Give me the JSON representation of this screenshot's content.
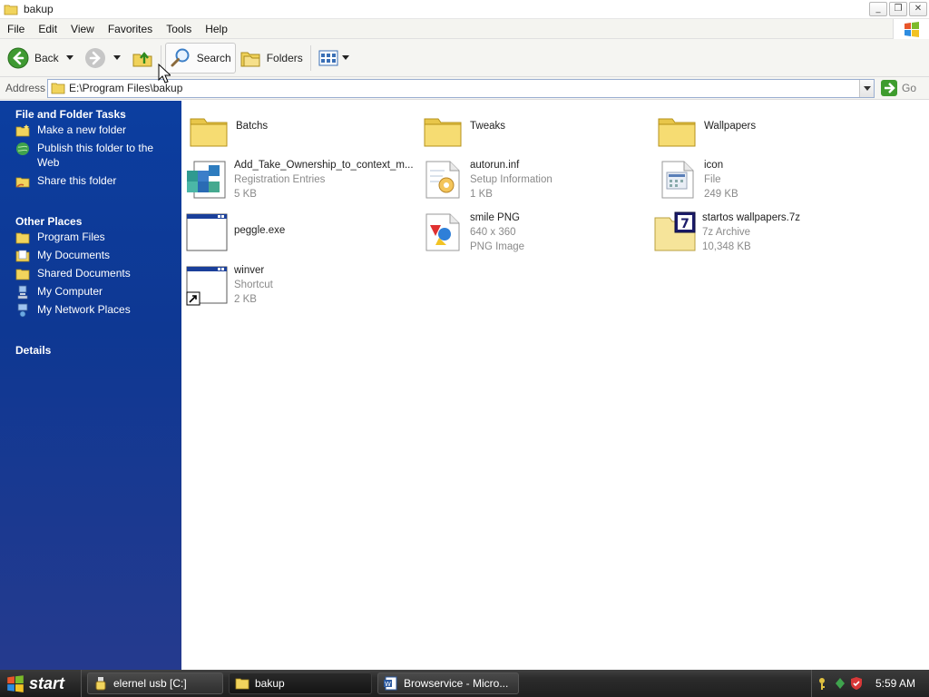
{
  "window": {
    "title": "bakup",
    "buttons": [
      "minimize",
      "maximize",
      "close"
    ]
  },
  "menu": [
    "File",
    "Edit",
    "View",
    "Favorites",
    "Tools",
    "Help"
  ],
  "toolbar": {
    "back_label": "Back",
    "search_label": "Search",
    "folders_label": "Folders"
  },
  "address": {
    "label": "Address",
    "path": "E:\\Program Files\\bakup",
    "go_label": "Go"
  },
  "leftpane": {
    "file_tasks_title": "File and Folder Tasks",
    "file_tasks": [
      {
        "label": "Make a new folder",
        "icon": "new-folder-icon"
      },
      {
        "label": "Publish this folder to the Web",
        "icon": "publish-web-icon"
      },
      {
        "label": "Share this folder",
        "icon": "share-folder-icon"
      }
    ],
    "other_places_title": "Other Places",
    "other_places": [
      {
        "label": "Program Files",
        "icon": "folder-icon"
      },
      {
        "label": "My Documents",
        "icon": "my-documents-icon"
      },
      {
        "label": "Shared Documents",
        "icon": "folder-icon"
      },
      {
        "label": "My Computer",
        "icon": "my-computer-icon"
      },
      {
        "label": "My Network Places",
        "icon": "network-places-icon"
      }
    ],
    "details_title": "Details"
  },
  "files": [
    {
      "name": "Batchs",
      "type": "",
      "size": "",
      "icon": "folder-icon"
    },
    {
      "name": "Tweaks",
      "type": "",
      "size": "",
      "icon": "folder-icon"
    },
    {
      "name": "Wallpapers",
      "type": "",
      "size": "",
      "icon": "folder-icon"
    },
    {
      "name": "Add_Take_Ownership_to_context_m...",
      "type": "Registration Entries",
      "size": "5 KB",
      "icon": "registry-file-icon"
    },
    {
      "name": "autorun.inf",
      "type": "Setup Information",
      "size": "1 KB",
      "icon": "setup-info-icon"
    },
    {
      "name": "icon",
      "type": "File",
      "size": "249 KB",
      "icon": "generic-file-icon"
    },
    {
      "name": "peggle.exe",
      "type": "",
      "size": "",
      "icon": "application-icon"
    },
    {
      "name": "smile PNG",
      "type": "640 x 360",
      "size": "PNG Image",
      "icon": "png-image-icon"
    },
    {
      "name": "startos wallpapers.7z",
      "type": "7z Archive",
      "size": "10,348 KB",
      "icon": "7z-archive-icon"
    },
    {
      "name": "winver",
      "type": "Shortcut",
      "size": "2 KB",
      "icon": "shortcut-icon"
    }
  ],
  "taskbar": {
    "start_label": "start",
    "tasks": [
      {
        "label": "elernel usb [C:]",
        "icon": "usb-icon"
      },
      {
        "label": "bakup",
        "icon": "folder-icon"
      },
      {
        "label": "Browservice - Micro...",
        "icon": "word-doc-icon"
      }
    ],
    "clock": "5:59 AM"
  }
}
